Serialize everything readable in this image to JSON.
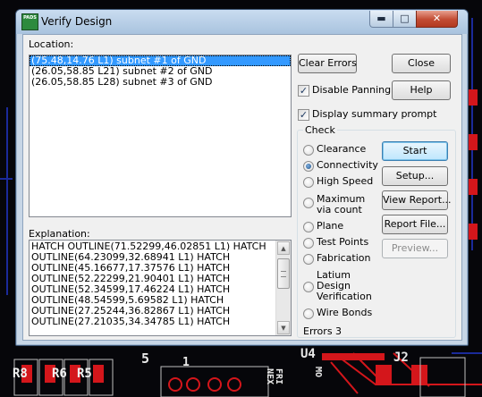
{
  "pcb": {
    "labels": [
      "R8",
      "R6",
      "R5",
      "5",
      "1",
      "U4",
      "J2"
    ],
    "vertical_texts": [
      "FRI",
      "NEX",
      "MO"
    ]
  },
  "window": {
    "title": "Verify Design",
    "icon_label": "PADS",
    "minimize_label": "▬",
    "maximize_label": "□",
    "close_label": "✕"
  },
  "location": {
    "label": "Location:",
    "items": [
      "(75.48,14.76 L1) subnet #1 of GND",
      "(26.05,58.85 L21) subnet #2 of GND",
      "(26.05,58.85 L28) subnet #3 of GND"
    ],
    "selected_index": 0
  },
  "explanation": {
    "label": "Explanation:",
    "lines": [
      "HATCH OUTLINE(71.52299,46.02851 L1) HATCH",
      "OUTLINE(64.23099,32.68941 L1) HATCH",
      "OUTLINE(45.16677,17.37576 L1) HATCH",
      "OUTLINE(52.22299,21.90401 L1) HATCH",
      "OUTLINE(52.34599,17.46224 L1) HATCH",
      "OUTLINE(48.54599,5.69582 L1) HATCH",
      "OUTLINE(27.25244,36.82867 L1) HATCH",
      "OUTLINE(27.21035,34.34785 L1) HATCH"
    ]
  },
  "buttons": {
    "clear_errors": "Clear Errors",
    "close": "Close",
    "help": "Help",
    "start": "Start",
    "setup": "Setup...",
    "view_report": "View Report...",
    "report_file": "Report File...",
    "preview": "Preview..."
  },
  "options": {
    "disable_panning": {
      "label": "Disable Panning",
      "checked": true
    },
    "display_summary_prompt": {
      "label": "Display summary prompt",
      "checked": true
    }
  },
  "check": {
    "title": "Check",
    "selected": "Connectivity",
    "options": [
      "Clearance",
      "Connectivity",
      "High Speed",
      "Maximum via count",
      "Plane",
      "Test Points",
      "Fabrication",
      "Latium Design Verification",
      "Wire Bonds"
    ]
  },
  "errors": {
    "label": "Errors",
    "count": "3"
  },
  "colors": {
    "titlebar": "#b9cfe6",
    "selection": "#3399ff",
    "close_button": "#c24b32",
    "pcb_red": "#d4161b",
    "pcb_blue": "#1b2a9a"
  }
}
